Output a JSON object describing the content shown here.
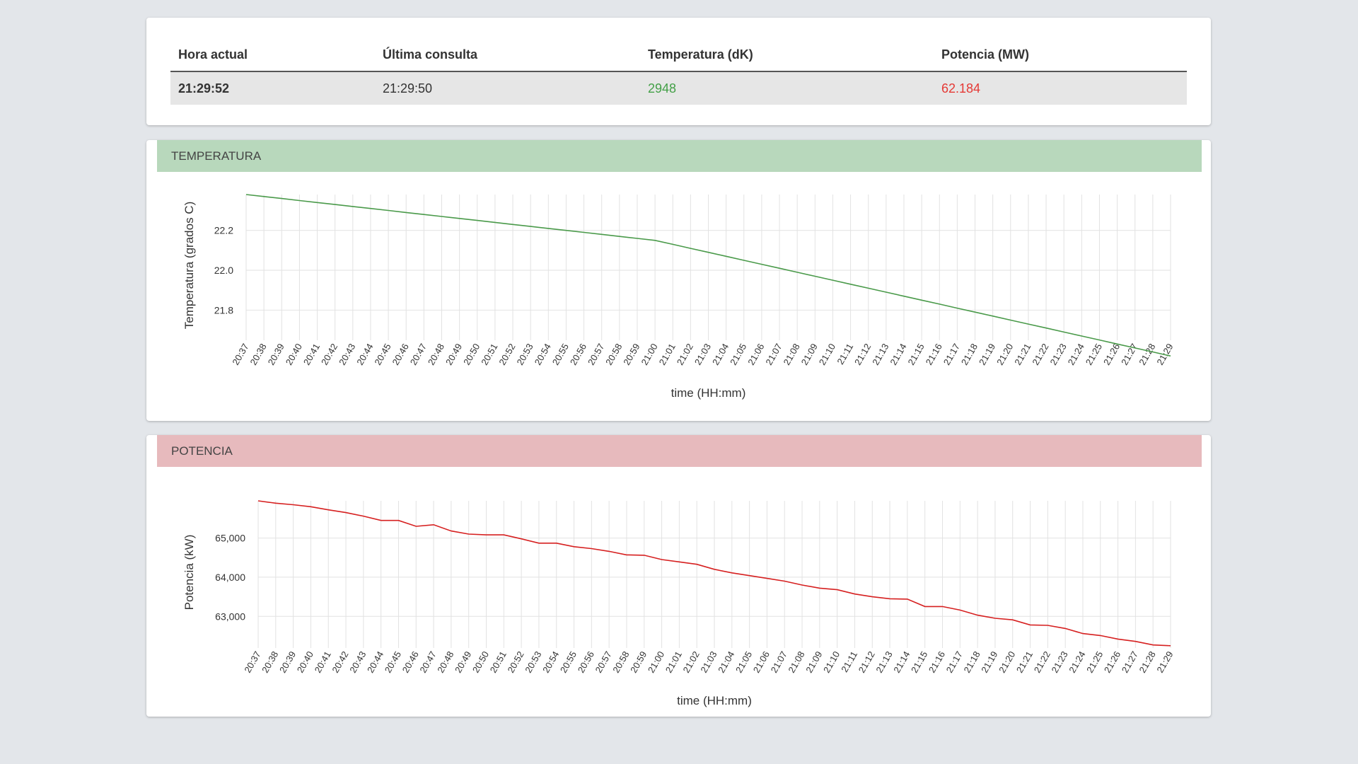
{
  "status": {
    "headers": [
      "Hora actual",
      "Última consulta",
      "Temperatura (dK)",
      "Potencia (MW)"
    ],
    "hora_actual": "21:29:52",
    "ultima_consulta": "21:29:50",
    "temperatura": "2948",
    "potencia": "62.184",
    "colors": {
      "temperatura": "#43a047",
      "potencia": "#e53935"
    }
  },
  "temp_panel": {
    "title": "TEMPERATURA",
    "header_color": "#b8d8bc"
  },
  "power_panel": {
    "title": "POTENCIA",
    "header_color": "#e7babd"
  },
  "chart_data": [
    {
      "type": "line",
      "xlabel": "time (HH:mm)",
      "ylabel": "Temperatura (grados C)",
      "yticks": [
        21.8,
        22.0,
        22.2
      ],
      "ylim": [
        21.67,
        22.38
      ],
      "grid": true,
      "line_color": "#4a9a4a",
      "x": [
        "20:37",
        "20:38",
        "20:39",
        "20:40",
        "20:41",
        "20:42",
        "20:43",
        "20:44",
        "20:45",
        "20:46",
        "20:47",
        "20:48",
        "20:49",
        "20:50",
        "20:51",
        "20:52",
        "20:53",
        "20:54",
        "20:55",
        "20:56",
        "20:57",
        "20:58",
        "20:59",
        "21:00",
        "21:01",
        "21:02",
        "21:03",
        "21:04",
        "21:05",
        "21:06",
        "21:07",
        "21:08",
        "21:09",
        "21:10",
        "21:11",
        "21:12",
        "21:13",
        "21:14",
        "21:15",
        "21:16",
        "21:17",
        "21:18",
        "21:19",
        "21:20",
        "21:21",
        "21:22",
        "21:23",
        "21:24",
        "21:25",
        "21:26",
        "21:27",
        "21:28",
        "21:29"
      ],
      "y": [
        22.38,
        22.37,
        22.36,
        22.35,
        22.34,
        22.33,
        22.32,
        22.31,
        22.3,
        22.29,
        22.28,
        22.27,
        22.26,
        22.25,
        22.24,
        22.23,
        22.22,
        22.21,
        22.2,
        22.19,
        22.18,
        22.17,
        22.16,
        22.15,
        22.13,
        22.11,
        22.09,
        22.07,
        22.05,
        22.03,
        22.01,
        21.99,
        21.97,
        21.95,
        21.93,
        21.91,
        21.89,
        21.87,
        21.85,
        21.83,
        21.81,
        21.79,
        21.77,
        21.75,
        21.73,
        21.71,
        21.69,
        21.67,
        21.65,
        21.63,
        21.61,
        21.59,
        21.57
      ]
    },
    {
      "type": "line",
      "xlabel": "time (HH:mm)",
      "ylabel": "Potencia (kW)",
      "yticks": [
        63000,
        64000,
        65000
      ],
      "ylim": [
        62300,
        65950
      ],
      "grid": true,
      "line_color": "#d62020",
      "x": [
        "20:37",
        "20:38",
        "20:39",
        "20:40",
        "20:41",
        "20:42",
        "20:43",
        "20:44",
        "20:45",
        "20:46",
        "20:47",
        "20:48",
        "20:49",
        "20:50",
        "20:51",
        "20:52",
        "20:53",
        "20:54",
        "20:55",
        "20:56",
        "20:57",
        "20:58",
        "20:59",
        "21:00",
        "21:01",
        "21:02",
        "21:03",
        "21:04",
        "21:05",
        "21:06",
        "21:07",
        "21:08",
        "21:09",
        "21:10",
        "21:11",
        "21:12",
        "21:13",
        "21:14",
        "21:15",
        "21:16",
        "21:17",
        "21:18",
        "21:19",
        "21:20",
        "21:21",
        "21:22",
        "21:23",
        "21:24",
        "21:25",
        "21:26",
        "21:27",
        "21:28",
        "21:29"
      ],
      "y": [
        65950,
        65890,
        65850,
        65800,
        65720,
        65650,
        65560,
        65450,
        65450,
        65300,
        65340,
        65180,
        65100,
        65080,
        65080,
        64980,
        64870,
        64870,
        64780,
        64730,
        64660,
        64570,
        64560,
        64450,
        64390,
        64330,
        64200,
        64110,
        64040,
        63970,
        63900,
        63800,
        63720,
        63680,
        63570,
        63500,
        63450,
        63440,
        63250,
        63250,
        63160,
        63030,
        62950,
        62910,
        62780,
        62770,
        62690,
        62560,
        62510,
        62420,
        62360,
        62270,
        62250
      ]
    }
  ]
}
